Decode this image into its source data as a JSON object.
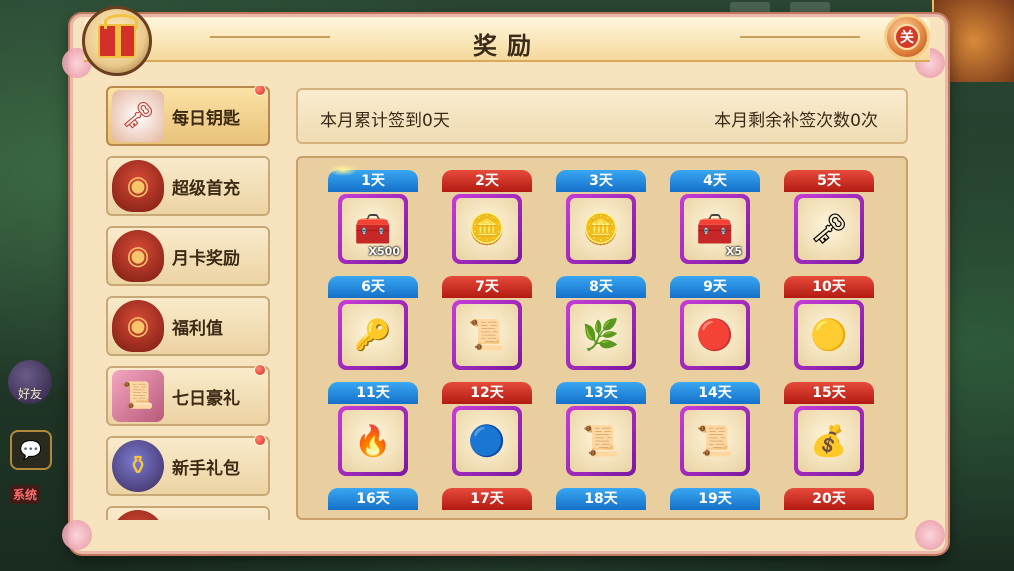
{
  "window": {
    "title": "奖励"
  },
  "background_hud": {
    "friend_label": "好友",
    "system_label": "系统"
  },
  "close_button": {
    "label": "关"
  },
  "sidebar": {
    "items": [
      {
        "label": "每日钥匙",
        "icon": "key-icon",
        "active": true,
        "badge": true
      },
      {
        "label": "超级首充",
        "icon": "basket-icon",
        "active": false,
        "badge": false
      },
      {
        "label": "月卡奖励",
        "icon": "basket-icon",
        "active": false,
        "badge": false
      },
      {
        "label": "福利值",
        "icon": "basket-icon",
        "active": false,
        "badge": false
      },
      {
        "label": "七日豪礼",
        "icon": "scroll-icon",
        "active": false,
        "badge": true
      },
      {
        "label": "新手礼包",
        "icon": "jar-icon",
        "active": false,
        "badge": true
      },
      {
        "label": "",
        "icon": "basket-icon",
        "active": false,
        "badge": false
      }
    ]
  },
  "info": {
    "signed_text": "本月累计签到0天",
    "remaining_text": "本月剩余补签次数0次"
  },
  "rewards": [
    {
      "day": "1天",
      "color": "blue",
      "icon": "treasure-chest-icon",
      "glyph": "🧰",
      "qty": "X500"
    },
    {
      "day": "2天",
      "color": "red",
      "icon": "gold-ingot-icon",
      "glyph": "🪙",
      "qty": ""
    },
    {
      "day": "3天",
      "color": "blue",
      "icon": "gold-ingot-icon",
      "glyph": "🪙",
      "qty": ""
    },
    {
      "day": "4天",
      "color": "blue",
      "icon": "treasure-chest-icon",
      "glyph": "🧰",
      "qty": "X5"
    },
    {
      "day": "5天",
      "color": "red",
      "icon": "key-icon",
      "glyph": "🗝",
      "qty": ""
    },
    {
      "day": "6天",
      "color": "blue",
      "icon": "gold-key-icon",
      "glyph": "🔑",
      "qty": ""
    },
    {
      "day": "7天",
      "color": "red",
      "icon": "scroll-icon",
      "glyph": "📜",
      "qty": ""
    },
    {
      "day": "8天",
      "color": "blue",
      "icon": "wood-orb-icon",
      "glyph": "🌿",
      "qty": ""
    },
    {
      "day": "9天",
      "color": "blue",
      "icon": "fire-orb-icon",
      "glyph": "🔴",
      "qty": ""
    },
    {
      "day": "10天",
      "color": "red",
      "icon": "gold-orb-icon",
      "glyph": "🟡",
      "qty": ""
    },
    {
      "day": "11天",
      "color": "blue",
      "icon": "earth-orb-icon",
      "glyph": "🔥",
      "qty": ""
    },
    {
      "day": "12天",
      "color": "red",
      "icon": "water-orb-icon",
      "glyph": "🔵",
      "qty": ""
    },
    {
      "day": "13天",
      "color": "blue",
      "icon": "map-scroll-icon",
      "glyph": "📜",
      "qty": ""
    },
    {
      "day": "14天",
      "color": "blue",
      "icon": "map-scroll-icon",
      "glyph": "📜",
      "qty": ""
    },
    {
      "day": "15天",
      "color": "red",
      "icon": "treasure-box-icon",
      "glyph": "💰",
      "qty": ""
    },
    {
      "day": "16天",
      "color": "blue",
      "icon": "",
      "glyph": "",
      "qty": ""
    },
    {
      "day": "17天",
      "color": "red",
      "icon": "",
      "glyph": "",
      "qty": ""
    },
    {
      "day": "18天",
      "color": "blue",
      "icon": "",
      "glyph": "",
      "qty": ""
    },
    {
      "day": "19天",
      "color": "blue",
      "icon": "",
      "glyph": "",
      "qty": ""
    },
    {
      "day": "20天",
      "color": "red",
      "icon": "",
      "glyph": "",
      "qty": ""
    }
  ]
}
